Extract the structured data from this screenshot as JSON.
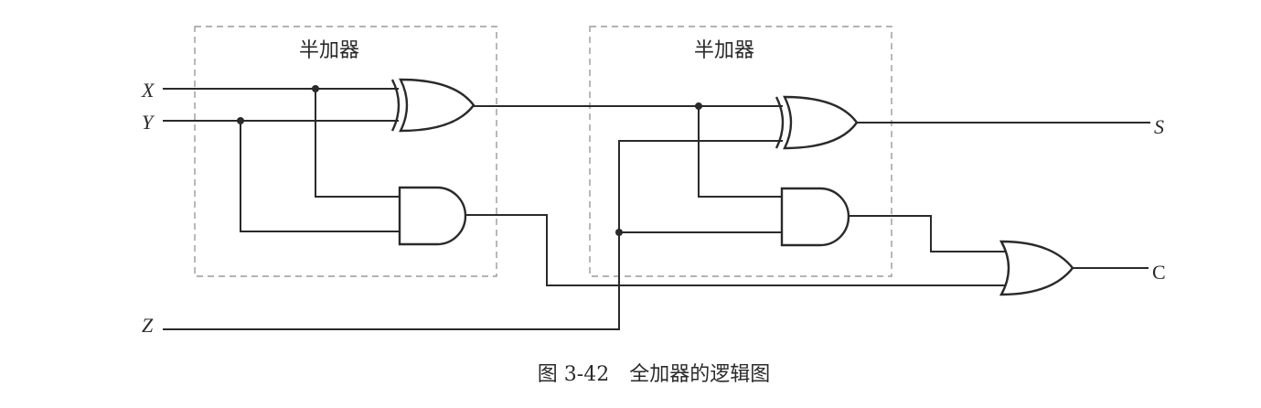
{
  "diagram": {
    "blocks": [
      {
        "id": "ha1",
        "label": "半加器"
      },
      {
        "id": "ha2",
        "label": "半加器"
      }
    ],
    "inputs": [
      {
        "id": "x",
        "label": "X"
      },
      {
        "id": "y",
        "label": "Y"
      },
      {
        "id": "z",
        "label": "Z"
      }
    ],
    "outputs": [
      {
        "id": "s",
        "label": "S"
      },
      {
        "id": "c",
        "label": "C"
      }
    ],
    "gates": [
      {
        "id": "xor1",
        "type": "XOR",
        "block": "ha1",
        "inputs": [
          "X",
          "Y"
        ]
      },
      {
        "id": "and1",
        "type": "AND",
        "block": "ha1",
        "inputs": [
          "X",
          "Y"
        ]
      },
      {
        "id": "xor2",
        "type": "XOR",
        "block": "ha2",
        "inputs": [
          "xor1",
          "Z"
        ],
        "output": "S"
      },
      {
        "id": "and2",
        "type": "AND",
        "block": "ha2",
        "inputs": [
          "xor1",
          "Z"
        ]
      },
      {
        "id": "or1",
        "type": "OR",
        "inputs": [
          "and2",
          "and1"
        ],
        "output": "C"
      }
    ],
    "caption": "图 3-42　全加器的逻辑图"
  }
}
